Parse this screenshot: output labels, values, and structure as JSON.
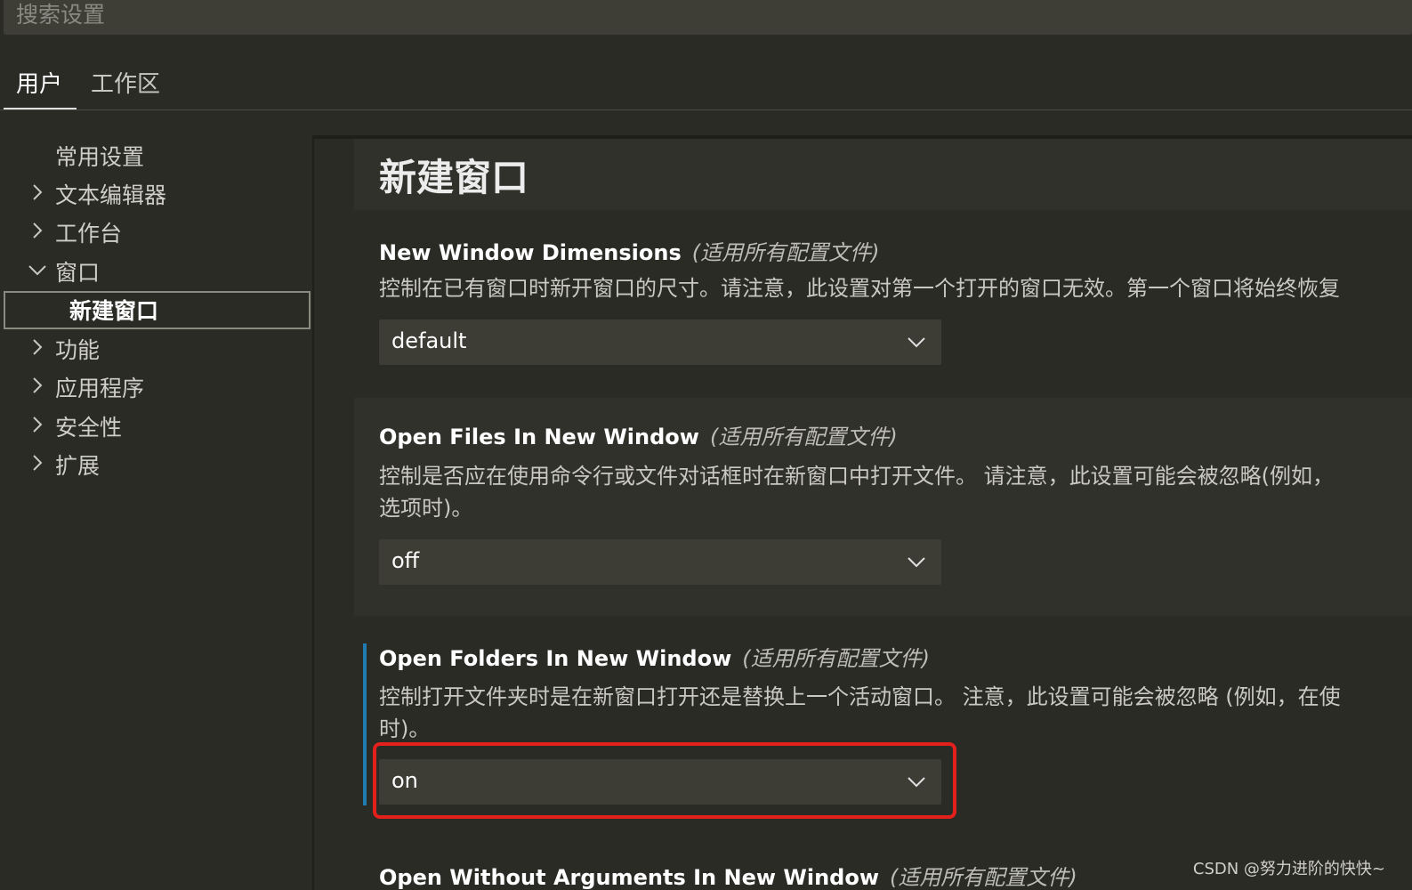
{
  "search": {
    "placeholder": "搜索设置"
  },
  "tabs": [
    {
      "label": "用户",
      "active": true
    },
    {
      "label": "工作区",
      "active": false
    }
  ],
  "sidebar": {
    "items": [
      {
        "label": "常用设置",
        "expander": "none"
      },
      {
        "label": "文本编辑器",
        "expander": "collapsed"
      },
      {
        "label": "工作台",
        "expander": "collapsed"
      },
      {
        "label": "窗口",
        "expander": "expanded"
      },
      {
        "label": "新建窗口",
        "expander": "none",
        "selected": true
      },
      {
        "label": "功能",
        "expander": "collapsed"
      },
      {
        "label": "应用程序",
        "expander": "collapsed"
      },
      {
        "label": "安全性",
        "expander": "collapsed"
      },
      {
        "label": "扩展",
        "expander": "collapsed"
      }
    ]
  },
  "main": {
    "section_title": "新建窗口",
    "settings": [
      {
        "name": "New Window Dimensions",
        "scope": "(适用所有配置文件)",
        "description": "控制在已有窗口时新开窗口的尺寸。请注意，此设置对第一个打开的窗口无效。第一个窗口将始终恢复",
        "value": "default"
      },
      {
        "name": "Open Files In New Window",
        "scope": "(适用所有配置文件)",
        "description_line1": "控制是否应在使用命令行或文件对话框时在新窗口中打开文件。 请注意，此设置可能会被忽略(例如，",
        "description_line2": "选项时)。",
        "value": "off"
      },
      {
        "name": "Open Folders In New Window",
        "scope": "(适用所有配置文件)",
        "description_line1": "控制打开文件夹时是在新窗口打开还是替换上一个活动窗口。 注意，此设置可能会被忽略 (例如，在使",
        "description_line2": "时)。",
        "value": "on"
      },
      {
        "name": "Open Without Arguments In New Window",
        "scope": "(适用所有配置文件)"
      }
    ]
  },
  "watermark": "CSDN @努力进阶的快快~",
  "colors": {
    "background": "#2b2b26",
    "panel": "#31312b",
    "dropdown": "#3d3d36",
    "focus_bar": "#1f7bb0",
    "highlight": "#e3201c"
  },
  "icons": {
    "collapsed": "chevron-right-icon",
    "expanded": "chevron-down-icon",
    "dropdown": "chevron-down-icon"
  }
}
